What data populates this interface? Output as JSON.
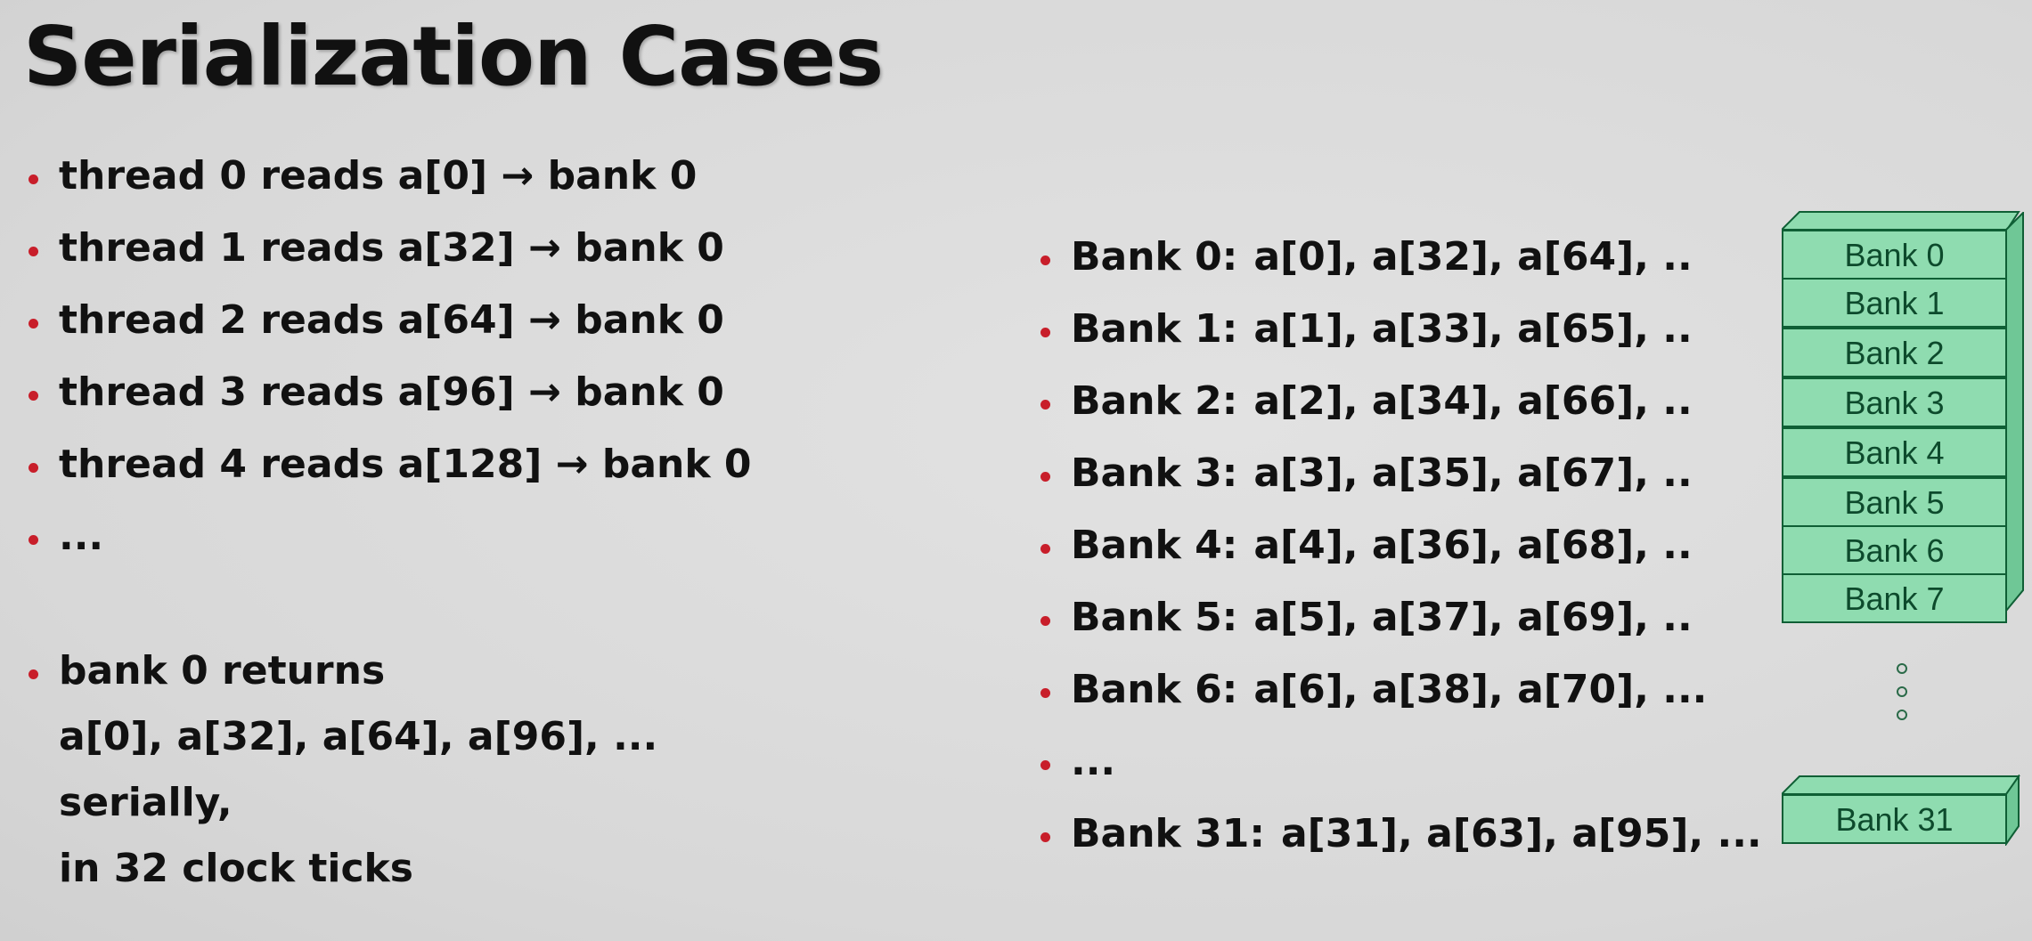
{
  "title": "Serialization Cases",
  "left_bullets": [
    "thread 0 reads a[0] → bank 0",
    "thread 1 reads a[32] → bank 0",
    "thread 2 reads a[64] → bank 0",
    "thread 3 reads a[96] → bank 0",
    "thread 4 reads a[128] → bank 0",
    "..."
  ],
  "returns_bullet": {
    "line1": "bank 0 returns",
    "line2": "a[0], a[32], a[64], a[96], ...",
    "line3": "serially,",
    "line4": "in 32 clock ticks"
  },
  "right_bullets": [
    {
      "label": "Bank 0:",
      "values": "a[0],  a[32],  a[64], .."
    },
    {
      "label": "Bank 1:",
      "values": "a[1],  a[33],  a[65], .."
    },
    {
      "label": "Bank 2:",
      "values": "a[2],  a[34],  a[66], .."
    },
    {
      "label": "Bank 3:",
      "values": "a[3],  a[35],  a[67], .."
    },
    {
      "label": "Bank 4:",
      "values": "a[4],  a[36],  a[68], .."
    },
    {
      "label": "Bank 5:",
      "values": "a[5],  a[37],  a[69], .."
    },
    {
      "label": "Bank 6:",
      "values": "a[6],  a[38],  a[70], ..."
    },
    {
      "label": "...",
      "values": ""
    },
    {
      "label": "Bank 31:",
      "values": "a[31],  a[63],  a[95], ..."
    }
  ],
  "bank_stack": [
    "Bank 0",
    "Bank 1",
    "Bank 2",
    "Bank 3",
    "Bank 4",
    "Bank 5",
    "Bank 6",
    "Bank 7"
  ],
  "bank_last": "Bank 31",
  "colors": {
    "bullet": "#c81e2a",
    "bank_fill": "#8fdcb0",
    "bank_border": "#0f5f35"
  }
}
